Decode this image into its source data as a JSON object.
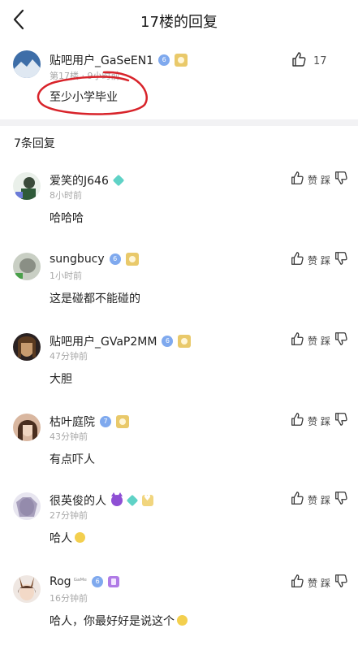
{
  "header": {
    "title": "17楼的回复"
  },
  "main_post": {
    "username": "贴吧用户_GaSeEN1",
    "level": "6",
    "meta": "第17楼 · 9小时前",
    "content": "至少小学毕业",
    "likes": "17"
  },
  "reply_count": "7条回复",
  "actions": {
    "like": "赞",
    "dislike": "踩"
  },
  "replies": [
    {
      "username": "爱笑的J646",
      "time": "8小时前",
      "content": "哈哈哈"
    },
    {
      "username": "sungbucy",
      "level": "6",
      "time": "1小时前",
      "content": "这是碰都不能碰的"
    },
    {
      "username": "贴吧用户_GVaP2MM",
      "level": "6",
      "time": "47分钟前",
      "content": "大胆"
    },
    {
      "username": "枯叶庭院",
      "level": "7",
      "time": "43分钟前",
      "content": "有点吓人"
    },
    {
      "username": "很英俊的人",
      "level": "1",
      "time": "27分钟前",
      "content": "哈人"
    },
    {
      "username": "Rog",
      "tag": "ᴳᵃᴹᵉ",
      "level": "6",
      "time": "16分钟前",
      "content": "哈人，你最好好是说这个"
    }
  ]
}
